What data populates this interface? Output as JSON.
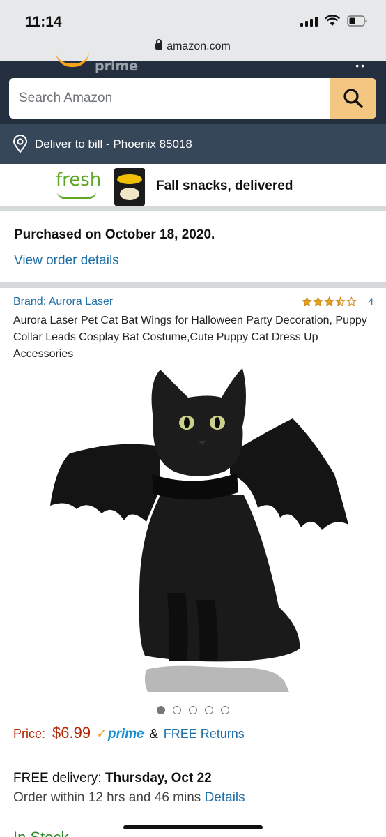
{
  "status_bar": {
    "time": "11:14",
    "url": "amazon.com"
  },
  "header": {
    "logo_text": "prime",
    "search_placeholder": "Search Amazon"
  },
  "deliver": {
    "text": "Deliver to bill - Phoenix 85018"
  },
  "fresh_banner": {
    "logo": "fresh",
    "text": "Fall snacks, delivered"
  },
  "order": {
    "purchased": "Purchased on October 18, 2020.",
    "view_details": "View order details"
  },
  "product": {
    "brand": "Brand: Aurora Laser",
    "rating_stars": 3.5,
    "rating_count": "4",
    "title": "Aurora Laser Pet Cat Bat Wings for Halloween Party Decoration, Puppy Collar Leads Cosplay Bat Costume,Cute Puppy Cat Dress Up Accessories",
    "image_icon": "black-cat-bat-wings-image",
    "carousel_count": 5,
    "carousel_active": 1
  },
  "pricing": {
    "label": "Price:",
    "value": "$6.99",
    "prime": "prime",
    "ampersand": "&",
    "free_returns": "FREE Returns"
  },
  "delivery": {
    "prefix": "FREE delivery: ",
    "date": "Thursday, Oct 22",
    "order_within": "Order within 12 hrs and 46 mins ",
    "details": "Details"
  },
  "stock": {
    "text": "In Stock"
  },
  "colors": {
    "header_bg": "#232f3e",
    "deliver_bg": "#37475a",
    "search_button": "#f3c681",
    "price": "#b12704",
    "link": "#1f6fa8",
    "prime": "#1a8fd4",
    "in_stock": "#2a8a2a"
  }
}
